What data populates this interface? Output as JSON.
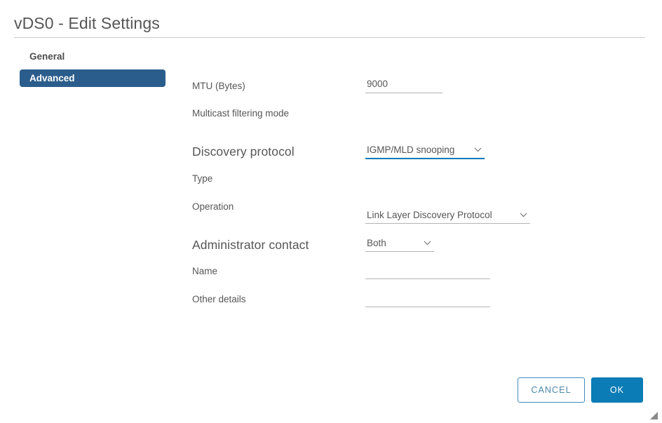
{
  "dialog": {
    "title": "vDS0 - Edit Settings"
  },
  "sidebar": {
    "tabs": [
      {
        "label": "General",
        "selected": false
      },
      {
        "label": "Advanced",
        "selected": true
      }
    ]
  },
  "form": {
    "mtu": {
      "label": "MTU (Bytes)",
      "value": "9000"
    },
    "multicast_filtering_mode": {
      "label": "Multicast filtering mode",
      "value": "IGMP/MLD snooping"
    },
    "discovery_protocol": {
      "heading": "Discovery protocol",
      "type": {
        "label": "Type",
        "value": "Link Layer Discovery Protocol"
      },
      "operation": {
        "label": "Operation",
        "value": "Both"
      }
    },
    "administrator_contact": {
      "heading": "Administrator contact",
      "name": {
        "label": "Name",
        "value": ""
      },
      "other_details": {
        "label": "Other details",
        "value": ""
      }
    }
  },
  "footer": {
    "cancel_label": "CANCEL",
    "ok_label": "OK"
  },
  "colors": {
    "accent_blue": "#0b7cb5",
    "focus_underline": "#0079b8",
    "tab_selected_bg": "#2b5d8c",
    "label_text": "#565656",
    "underline_gray": "#b3b3b3",
    "divider_gray": "#cccccc",
    "cancel_border": "#3c8dbc"
  }
}
